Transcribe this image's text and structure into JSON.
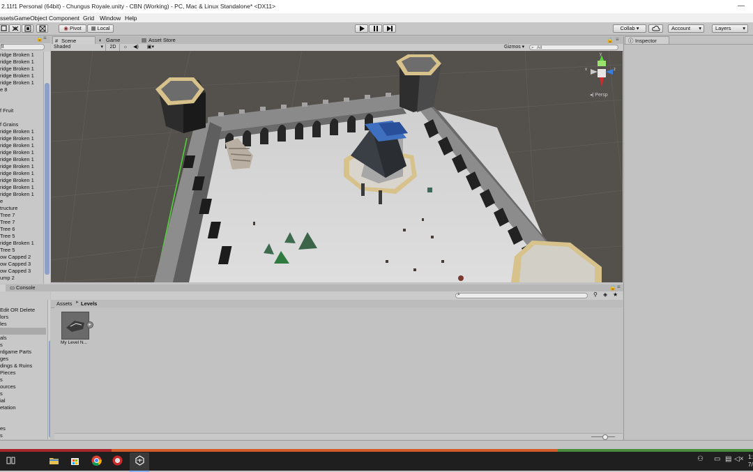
{
  "window": {
    "title": "2.11f1 Personal (64bit) - Chungus Royale.unity - CBN (Working) - PC, Mac & Linux Standalone* <DX11>",
    "minimize_glyph": "—"
  },
  "menu": [
    "ssets",
    "GameObject",
    "Component",
    "Grid",
    "Window",
    "Help"
  ],
  "toolbar": {
    "pivot_label": "Pivot",
    "local_label": "Local",
    "collab_label": "Collab ▾",
    "account_label": "Account",
    "layers_label": "Layers",
    "tool_icons": [
      "rect-tool-icon",
      "move-tool-icon",
      "scale-tool-icon",
      "transform-tool-icon"
    ],
    "play_icons": [
      "play-icon",
      "pause-icon",
      "step-icon"
    ]
  },
  "hierarchy": {
    "items": [
      {
        "label": "ridge Broken 1",
        "blue": false
      },
      {
        "label": "ridge Broken 1",
        "blue": false
      },
      {
        "label": "ridge Broken 1",
        "blue": false
      },
      {
        "label": "ridge Broken 1",
        "blue": false
      },
      {
        "label": "ridge Broken 1",
        "blue": false
      },
      {
        "label": "e 8",
        "blue": false
      },
      {
        "label": "",
        "blue": false
      },
      {
        "label": "",
        "blue": false
      },
      {
        "label": "f Fruit",
        "blue": false
      },
      {
        "label": "",
        "blue": false
      },
      {
        "label": "f Grains",
        "blue": false
      },
      {
        "label": "ridge Broken 1",
        "blue": false
      },
      {
        "label": "ridge Broken 1",
        "blue": false
      },
      {
        "label": "ridge Broken 1",
        "blue": false
      },
      {
        "label": "ridge Broken 1",
        "blue": false
      },
      {
        "label": "ridge Broken 1",
        "blue": false
      },
      {
        "label": "ridge Broken 1",
        "blue": false
      },
      {
        "label": "ridge Broken 1",
        "blue": false
      },
      {
        "label": "ridge Broken 1",
        "blue": false
      },
      {
        "label": "ridge Broken 1",
        "blue": false
      },
      {
        "label": "ridge Broken 1",
        "blue": false
      },
      {
        "label": "e",
        "blue": false
      },
      {
        "label": "tructure",
        "blue": false
      },
      {
        "label": " Tree 7",
        "blue": false
      },
      {
        "label": " Tree 7",
        "blue": false
      },
      {
        "label": " Tree 6",
        "blue": false
      },
      {
        "label": " Tree 5",
        "blue": false
      },
      {
        "label": "ridge Broken 1",
        "blue": false
      },
      {
        "label": " Tree 5",
        "blue": false
      },
      {
        "label": "ow Capped 2",
        "blue": false
      },
      {
        "label": "ow Capped 3",
        "blue": false
      },
      {
        "label": "ow Capped 3",
        "blue": false
      },
      {
        "label": "ump 2",
        "blue": false
      }
    ],
    "search_fragment": "ll"
  },
  "scene": {
    "tabs": [
      {
        "label": "Scene",
        "icon": "scene-tab-icon",
        "active": true
      },
      {
        "label": "Game",
        "icon": "game-tab-icon",
        "active": false
      },
      {
        "label": "Asset Store",
        "icon": "asset-store-tab-icon",
        "active": false
      }
    ],
    "shading_mode": "Shaded",
    "mode_2d": "2D",
    "gizmos_label": "Gizmos ▾",
    "search_placeholder": "All",
    "gizmo_label": "Persp",
    "axis_labels": {
      "x": "x",
      "y": "y",
      "z": "z"
    }
  },
  "inspector": {
    "tab_label": "Inspector",
    "icon": "info-icon"
  },
  "bottom": {
    "tabs": [
      {
        "label": "",
        "icon": "project-tab-icon"
      },
      {
        "label": "Console",
        "icon": "console-tab-icon"
      }
    ]
  },
  "project": {
    "items": [
      {
        "label": " Edit OR Delete",
        "selected": false
      },
      {
        "label": "lors",
        "selected": false
      },
      {
        "label": "les",
        "selected": false
      },
      {
        "label": "",
        "selected": true
      },
      {
        "label": "als",
        "selected": false
      },
      {
        "label": "s",
        "selected": false
      },
      {
        "label": "rdgame Parts",
        "selected": false
      },
      {
        "label": "ges",
        "selected": false
      },
      {
        "label": "dings & Ruins",
        "selected": false
      },
      {
        "label": " Pieces",
        "selected": false
      },
      {
        "label": "s",
        "selected": false
      },
      {
        "label": "ources",
        "selected": false
      },
      {
        "label": "s",
        "selected": false
      },
      {
        "label": "ial",
        "selected": false
      },
      {
        "label": "etation",
        "selected": false
      },
      {
        "label": "",
        "selected": false
      },
      {
        "label": "",
        "selected": false
      },
      {
        "label": "es",
        "selected": false
      },
      {
        "label": "s",
        "selected": false
      }
    ],
    "breadcrumb": {
      "root": "Assets",
      "sep": "►",
      "current": "Levels"
    },
    "assets": [
      {
        "label": "My Level N..."
      }
    ]
  },
  "taskbar": {
    "icons": [
      "task-view-icon",
      "file-explorer-icon",
      "store-icon",
      "chrome-icon",
      "chrome-alt-icon",
      "unity-icon"
    ],
    "tray_icons": [
      "people-icon",
      "network-icon",
      "speaker-icon",
      "chat-icon"
    ],
    "clock_fragment": "1:",
    "date_fragment": "7/"
  },
  "colors": {
    "editor_bg": "#c2c2c2",
    "viewport_bg": "#54504c",
    "taskbar_bg": "#1f1f1f",
    "selection": "#3e7de0",
    "castle_stone": "#7d7d7d",
    "castle_dark": "#2a2a2a",
    "tower_rim": "#d7c28c",
    "ground": "#d6d6d6"
  }
}
